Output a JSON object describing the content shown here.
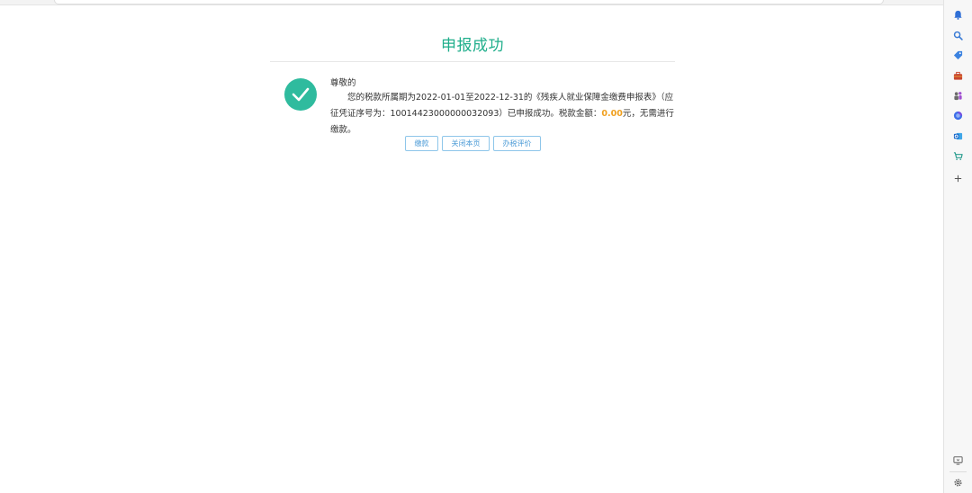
{
  "page": {
    "title": "申报成功",
    "greeting": "尊敬的",
    "message_before": "您的税款所属期为2022-01-01至2022-12-31的《残疾人就业保障金缴费申报表》（应征凭证序号为：10014423000000032093）已申报成功。税款金额：",
    "amount": "0.00",
    "message_after": "元，无需进行缴款。"
  },
  "buttons": {
    "pay": "缴款",
    "close": "关闭本页",
    "evaluate": "办税评价"
  },
  "sidebar": {
    "icons": [
      "bell-icon",
      "search-icon",
      "tag-icon",
      "briefcase-icon",
      "people-icon",
      "circle-app-icon",
      "outlook-icon",
      "cart-icon",
      "plus-icon",
      "screen-icon",
      "settings-icon"
    ]
  },
  "colors": {
    "accent_green": "#1fae8b",
    "check_circle": "#2fbb9e",
    "amount_orange": "#f0a020",
    "button_blue": "#4a9ad6"
  }
}
